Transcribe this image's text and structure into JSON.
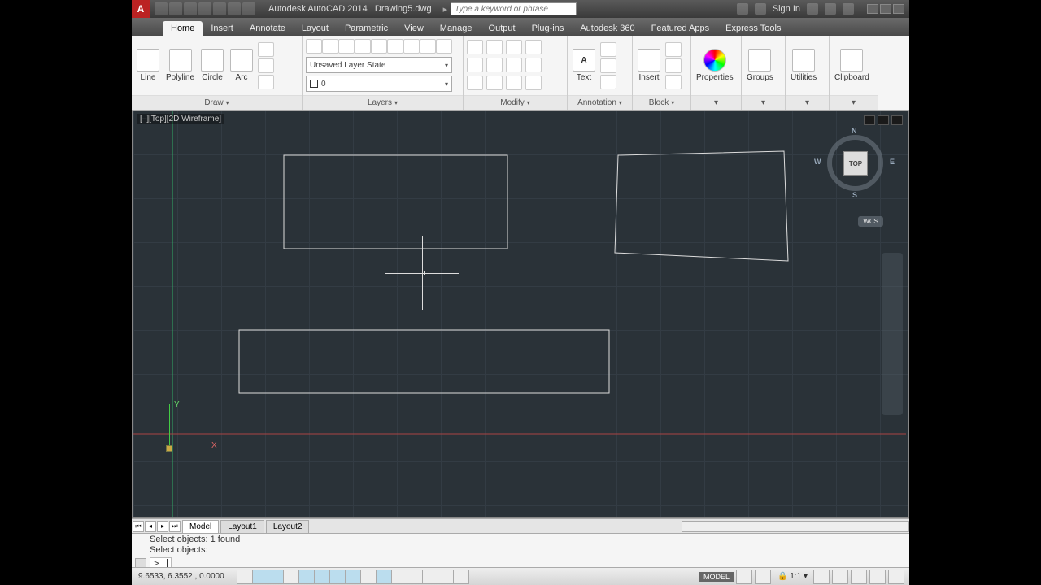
{
  "title": {
    "app": "Autodesk AutoCAD 2014",
    "file": "Drawing5.dwg"
  },
  "search_placeholder": "Type a keyword or phrase",
  "signin": "Sign In",
  "tabs": [
    "Home",
    "Insert",
    "Annotate",
    "Layout",
    "Parametric",
    "View",
    "Manage",
    "Output",
    "Plug-ins",
    "Autodesk 360",
    "Featured Apps",
    "Express Tools"
  ],
  "active_tab": "Home",
  "draw": {
    "line": "Line",
    "polyline": "Polyline",
    "circle": "Circle",
    "arc": "Arc",
    "title": "Draw"
  },
  "layers": {
    "state": "Unsaved Layer State",
    "current": "0",
    "title": "Layers"
  },
  "modify": {
    "title": "Modify"
  },
  "annotation": {
    "text": "Text",
    "title": "Annotation"
  },
  "block": {
    "insert": "Insert",
    "title": "Block"
  },
  "panels_right": {
    "properties": "Properties",
    "groups": "Groups",
    "utilities": "Utilities",
    "clipboard": "Clipboard"
  },
  "viewport": {
    "label": "[‒][Top][2D Wireframe]"
  },
  "viewcube": {
    "face": "TOP",
    "n": "N",
    "e": "E",
    "s": "S",
    "w": "W",
    "wcs": "WCS"
  },
  "ucs": {
    "x": "X",
    "y": "Y"
  },
  "layout_tabs": {
    "model": "Model",
    "l1": "Layout1",
    "l2": "Layout2"
  },
  "cmd": {
    "line1": "Select objects: 1 found",
    "line2": "Select objects:",
    "prompt": ">_"
  },
  "status": {
    "coords": "9.6533, 6.3552 , 0.0000",
    "model": "MODEL",
    "scale": "1:1"
  }
}
